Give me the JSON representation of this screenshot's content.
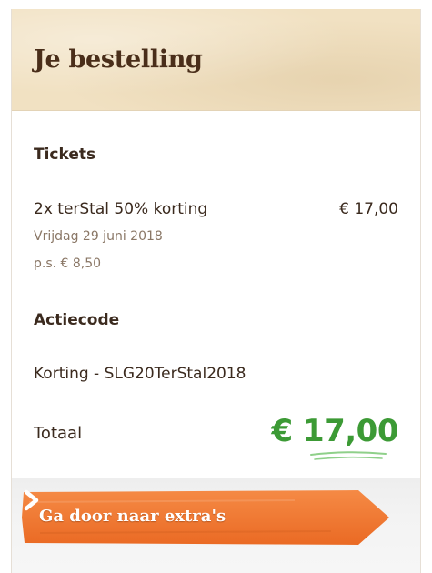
{
  "header": {
    "title": "Je bestelling"
  },
  "tickets": {
    "section_title": "Tickets",
    "item_name": "2x terStal 50% korting",
    "item_price": "€ 17,00",
    "item_date": "Vrijdag 29 juni 2018",
    "item_unit_price": "p.s. € 8,50"
  },
  "promo": {
    "section_title": "Actiecode",
    "code_text": "Korting - SLG20TerStal2018"
  },
  "total": {
    "label": "Totaal",
    "value": "€ 17,00"
  },
  "cta": {
    "label": "Ga door naar extra's",
    "icon": "chevron-right-icon"
  },
  "colors": {
    "accent_green": "#3c9a35",
    "cta_orange": "#f0742e",
    "header_bg": "#f1e1c2",
    "brown_text": "#4a2e1a"
  }
}
